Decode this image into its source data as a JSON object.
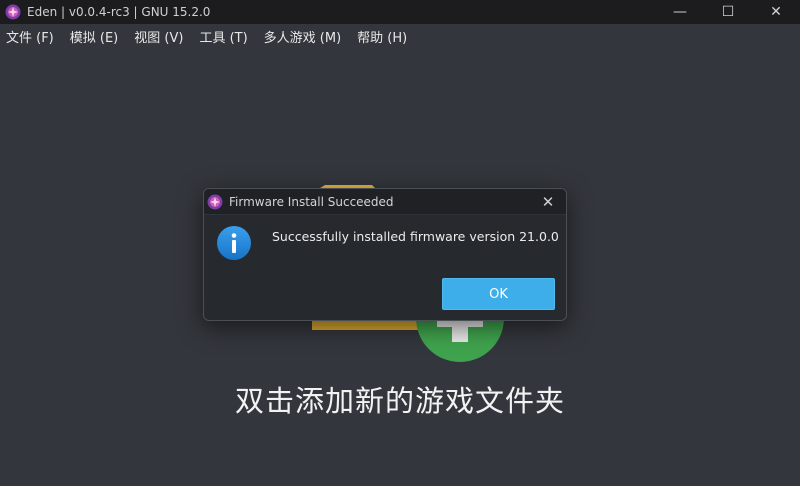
{
  "window": {
    "title": "Eden | v0.0.4-rc3 | GNU 15.2.0",
    "controls": {
      "minimize": "—",
      "maximize": "☐",
      "close": "✕"
    }
  },
  "menubar": {
    "items": [
      {
        "label": "文件 (F)"
      },
      {
        "label": "模拟 (E)"
      },
      {
        "label": "视图 (V)"
      },
      {
        "label": "工具 (T)"
      },
      {
        "label": "多人游戏 (M)"
      },
      {
        "label": "帮助 (H)"
      }
    ]
  },
  "main": {
    "empty_hint": "双击添加新的游戏文件夹",
    "folder_icon": "folder-icon",
    "add_icon": "plus-icon"
  },
  "dialog": {
    "title": "Firmware Install Succeeded",
    "close": "✕",
    "icon": "info-icon",
    "message": "Successfully installed firmware version 21.0.0",
    "ok_label": "OK"
  },
  "colors": {
    "background": "#33363c",
    "titlebar": "#1c1c1f",
    "dialog_bg": "#262a2f",
    "accent": "#3daee9",
    "folder": "#e8b93c",
    "plus_circle": "#3fa34d"
  }
}
